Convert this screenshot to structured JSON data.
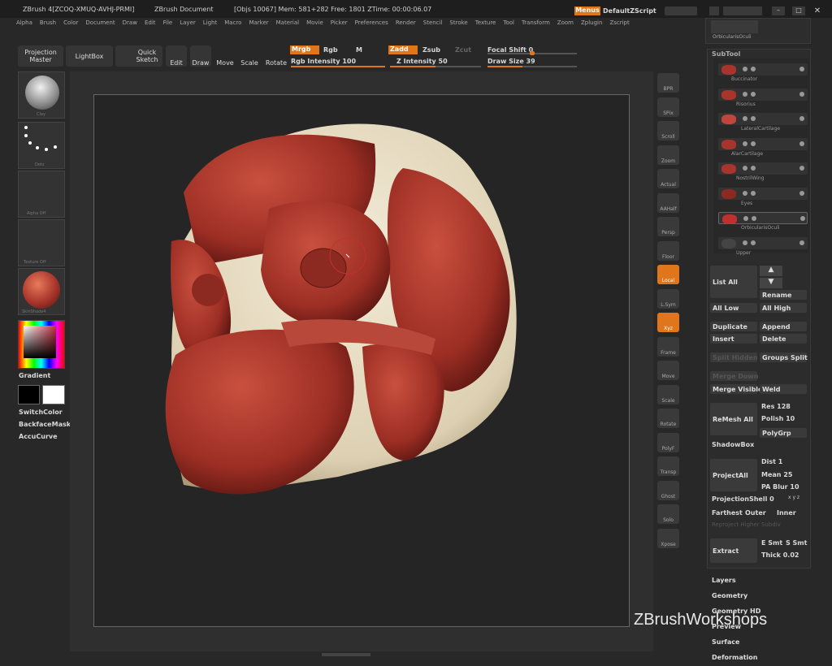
{
  "title_bar": {
    "app": "ZBrush 4[ZCOQ-XMUQ-AVHJ-PRMI]",
    "doc": "ZBrush Document",
    "stats": "[Objs 10067] Mem: 581+282  Free: 1801  ZTime: 00:00:06.07",
    "menus_label": "Menus",
    "script_label": "DefaultZScript"
  },
  "menu": [
    "Alpha",
    "Brush",
    "Color",
    "Document",
    "Draw",
    "Edit",
    "File",
    "Layer",
    "Light",
    "Macro",
    "Marker",
    "Material",
    "Movie",
    "Picker",
    "Preferences",
    "Render",
    "Stencil",
    "Stroke",
    "Texture",
    "Tool",
    "Transform",
    "Zoom",
    "Zplugin",
    "Zscript"
  ],
  "toolbar": {
    "projection_master": "Projection Master",
    "lightbox": "LightBox",
    "quick_sketch": "Quick Sketch",
    "edit": "Edit",
    "draw": "Draw",
    "move": "Move",
    "scale": "Scale",
    "rotate": "Rotate",
    "mrgb": "Mrgb",
    "rgb": "Rgb",
    "m": "M",
    "rgb_intensity": "Rgb Intensity 100",
    "zadd": "Zadd",
    "zsub": "Zsub",
    "zcut": "Zcut",
    "z_intensity": "Z Intensity 50",
    "focal_shift": "Focal Shift 0",
    "draw_size": "Draw Size 39",
    "rgb_intensity_value": 1.0,
    "z_intensity_value": 0.5,
    "draw_size_value": 0.39
  },
  "left_shelf": {
    "brush": "Clay",
    "stroke": "Dots",
    "alpha": "Alpha Off",
    "texture": "Texture Off",
    "material": "SkinShade4",
    "gradient": "Gradient",
    "switch_color": "SwitchColor",
    "backface": "BackfaceMask",
    "accucurve": "AccuCurve"
  },
  "right_shelf": [
    "BPR",
    "SPix",
    "Scroll",
    "Zoom",
    "Actual",
    "AAHalf",
    "Persp",
    "Floor",
    "Local",
    "L.Sym",
    "Xyz",
    "Frame",
    "Move",
    "Scale",
    "Rotate",
    "PolyF",
    "Transp",
    "Ghost",
    "Solo",
    "Xpose"
  ],
  "top_thumb_label": "OrbicularisOculi",
  "subtool": {
    "header": "SubTool",
    "items": [
      "Buccinator",
      "Risorius",
      "LateralCartilage",
      "AlarCartilage",
      "NostrilWing",
      "Eyes",
      "OrbicularisOculi",
      "Upper"
    ]
  },
  "panel": {
    "list_all": "List All",
    "rename": "Rename",
    "all_low": "All Low",
    "all_high": "All High",
    "duplicate": "Duplicate",
    "append": "Append",
    "insert": "Insert",
    "delete": "Delete",
    "split_hidden": "Split Hidden",
    "groups_split": "Groups Split",
    "merge_down": "Merge Down",
    "merge_visible": "Merge Visible",
    "weld": "Weld",
    "remesh_all": "ReMesh All",
    "res": "Res 128",
    "polish": "Polish 10",
    "polygrp": "PolyGrp",
    "shadowbox": "ShadowBox",
    "project_all": "ProjectAll",
    "dist": "Dist 1",
    "mean": "Mean 25",
    "pa_blur": "PA Blur 10",
    "projection_shell": "ProjectionShell 0",
    "farthest": "Farthest",
    "outer": "Outer",
    "inner": "Inner",
    "reproject": "Reproject Higher Subdiv",
    "extract": "Extract",
    "e_smt": "E Smt",
    "s_smt": "S Smt",
    "thick": "Thick 0.02",
    "xyz": "x y z"
  },
  "sections": [
    "Layers",
    "Geometry",
    "Geometry HD",
    "Preview",
    "Surface",
    "Deformation"
  ],
  "watermark": "ZBrushWorkshops",
  "colors": {
    "accent": "#e0761c",
    "muscle": "#a8352c",
    "bone": "#e6dcc4"
  }
}
